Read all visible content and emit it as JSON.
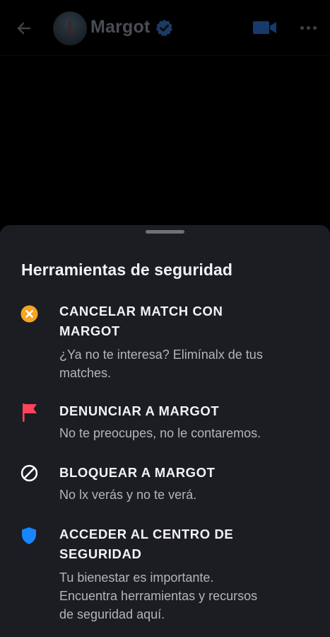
{
  "header": {
    "contact_name": "Margot",
    "back_icon": "arrow-left-icon",
    "verified_icon": "verified-check-icon",
    "video_icon": "video-camera-icon",
    "more_icon": "more-dots-icon"
  },
  "sheet": {
    "title": "Herramientas de seguridad",
    "options": [
      {
        "icon": "close-circle-icon",
        "icon_color": "#F5A524",
        "title_line1": "CANCELAR MATCH CON",
        "title_line2": "MARGOT",
        "desc_line1": "¿Ya no te interesa? Elimínalx de tus",
        "desc_line2": "matches."
      },
      {
        "icon": "flag-icon",
        "icon_color": "#FF4458",
        "title_line1": "DENUNCIAR A MARGOT",
        "desc_line1": "No te preocupes, no le contaremos."
      },
      {
        "icon": "block-icon",
        "icon_color": "#FFFFFF",
        "title_line1": "BLOQUEAR A MARGOT",
        "desc_line1": "No lx verás y no te verá."
      },
      {
        "icon": "shield-icon",
        "icon_color": "#1786FF",
        "title_line1": "ACCEDER AL CENTRO DE",
        "title_line2": "SEGURIDAD",
        "desc_line1": "Tu bienestar es importante.",
        "desc_line2": "Encuentra herramientas y recursos",
        "desc_line3": "de seguridad aquí."
      }
    ]
  }
}
